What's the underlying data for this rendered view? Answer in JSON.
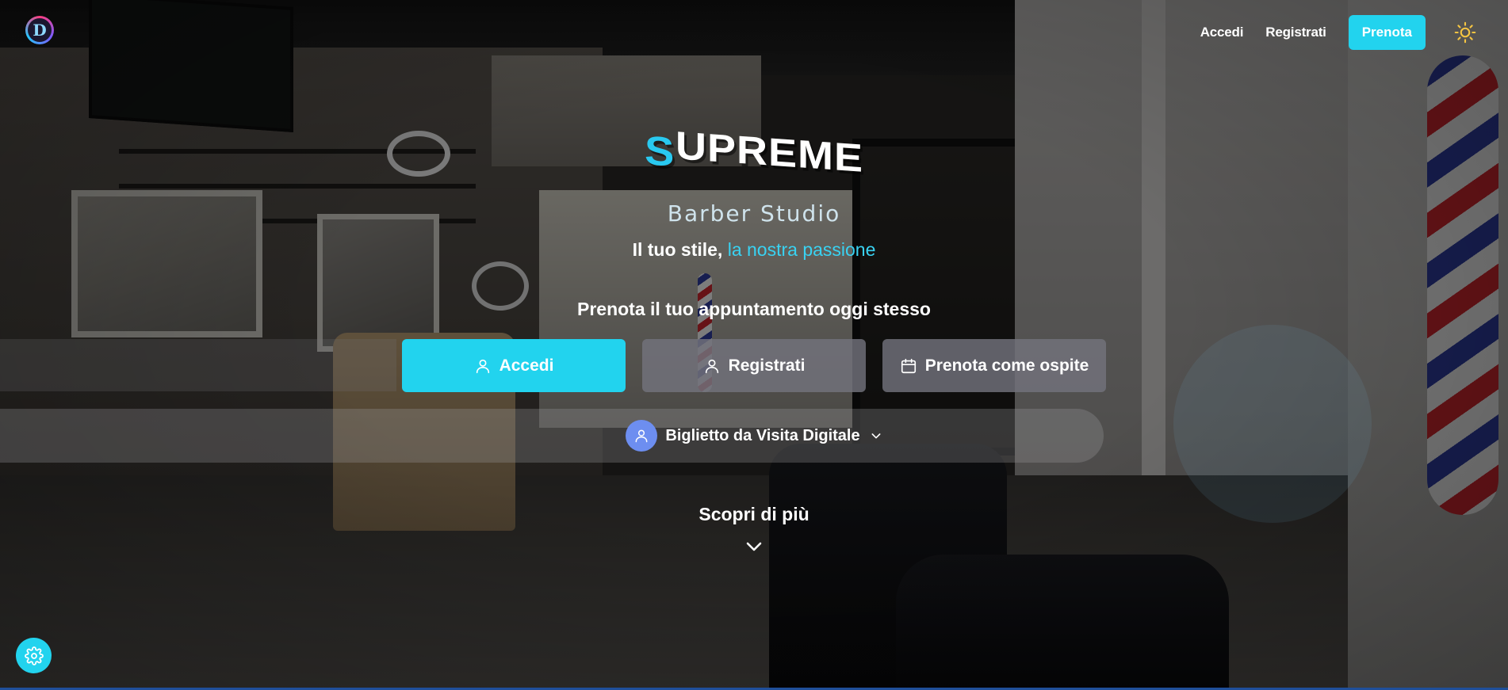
{
  "header": {
    "logo_letter": "D",
    "nav": {
      "login_label": "Accedi",
      "register_label": "Registrati",
      "book_label": "Prenota"
    },
    "theme_icon": "sun-icon"
  },
  "hero": {
    "brand_first": "S",
    "brand_rest": "UPREME",
    "subtitle": "Barber Studio",
    "tagline_main": "Il tuo stile,",
    "tagline_accent": "la nostra passione",
    "cta_title": "Prenota il tuo appuntamento oggi stesso",
    "buttons": {
      "login": {
        "label": "Accedi",
        "icon": "user-icon"
      },
      "register": {
        "label": "Registrati",
        "icon": "user-icon"
      },
      "guest": {
        "label": "Prenota come ospite",
        "icon": "calendar-icon"
      }
    },
    "business_card": {
      "label": "Biglietto da Visita Digitale",
      "icon": "user-icon",
      "expand_icon": "chevron-down-icon"
    },
    "discover_label": "Scopri di più"
  },
  "settings_icon": "gear-icon",
  "colors": {
    "accent": "#22d3ee",
    "accent_text": "#39d2f2",
    "secondary_button": "#73737d",
    "avatar": "#6d8ef0"
  }
}
